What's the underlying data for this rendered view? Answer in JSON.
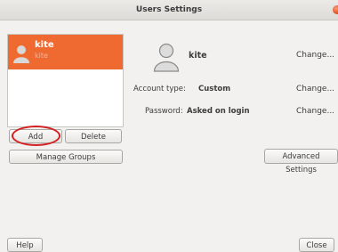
{
  "window": {
    "title": "Users Settings"
  },
  "user_list": {
    "selected_user": {
      "name": "kite",
      "subtitle": "kite"
    }
  },
  "buttons": {
    "add": "Add",
    "delete": "Delete",
    "manage_groups": "Manage Groups",
    "help": "Help",
    "close": "Close",
    "advanced_settings": "Advanced Settings"
  },
  "details": {
    "user_name": "kite",
    "change_label": "Change...",
    "account_type_label": "Account type:",
    "account_type_value": "Custom",
    "password_label": "Password:",
    "password_value": "Asked on login"
  },
  "colors": {
    "selection": "#ef6a31",
    "annotation_circle": "#d22020",
    "close_dot": "#df4b17"
  }
}
